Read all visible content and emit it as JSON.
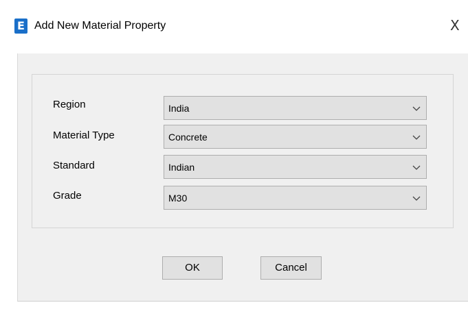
{
  "window": {
    "title": "Add New Material Property",
    "icon_letter": "E",
    "icon_name": "etabs-app-icon",
    "close_glyph": "X",
    "accent_color": "#1a6fc9"
  },
  "form": {
    "fields": [
      {
        "label": "Region",
        "value": "India"
      },
      {
        "label": "Material Type",
        "value": "Concrete"
      },
      {
        "label": "Standard",
        "value": "Indian"
      },
      {
        "label": "Grade",
        "value": "M30"
      }
    ]
  },
  "buttons": {
    "ok_label": "OK",
    "cancel_label": "Cancel"
  }
}
